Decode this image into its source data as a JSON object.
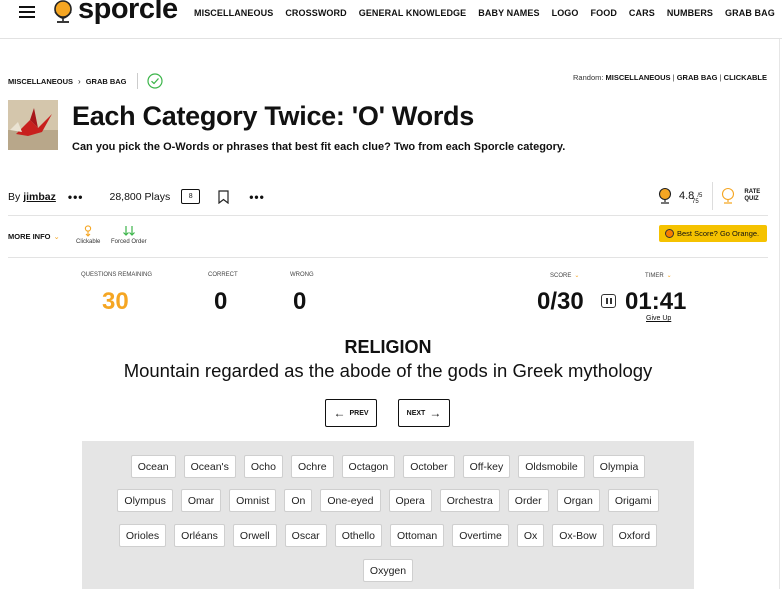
{
  "nav": {
    "logo": "sporcle",
    "links": [
      "MISCELLANEOUS",
      "CROSSWORD",
      "GENERAL KNOWLEDGE",
      "BABY NAMES",
      "LOGO",
      "FOOD",
      "CARS",
      "NUMBERS",
      "GRAB BAG"
    ]
  },
  "breadcrumb": {
    "first": "MISCELLANEOUS",
    "second": "GRAB BAG"
  },
  "random": {
    "label": "Random:",
    "links": [
      "MISCELLANEOUS",
      "GRAB BAG",
      "CLICKABLE"
    ]
  },
  "quiz": {
    "title": "Each Category Twice: 'O' Words",
    "subtitle": "Can you pick the O-Words or phrases that best fit each clue? Two from each Sporcle category.",
    "by_label": "By",
    "author": "jimbaz",
    "plays": "28,800 Plays",
    "comments": "8",
    "rating": "4.8",
    "rating_max": "/5",
    "rating_count": "75",
    "rate_label_1": "RATE",
    "rate_label_2": "QUIZ"
  },
  "info": {
    "more_info": "MORE INFO",
    "tags": [
      "Clickable",
      "Forced Order"
    ],
    "best_score": "Best Score? Go Orange."
  },
  "stats": {
    "remaining_label": "QUESTIONS REMAINING",
    "remaining": "30",
    "correct_label": "CORRECT",
    "correct": "0",
    "wrong_label": "WRONG",
    "wrong": "0",
    "score_label": "SCORE",
    "score": "0/30",
    "timer_label": "TIMER",
    "timer": "01:41",
    "give_up": "Give Up"
  },
  "question": {
    "category": "RELIGION",
    "clue": "Mountain regarded as the abode of the gods in Greek mythology",
    "prev": "PREV",
    "next": "NEXT"
  },
  "answers": [
    [
      "Ocean",
      "Ocean's",
      "Ocho",
      "Ochre",
      "Octagon",
      "October",
      "Off-key",
      "Oldsmobile",
      "Olympia"
    ],
    [
      "Olympus",
      "Omar",
      "Omnist",
      "On",
      "One-eyed",
      "Opera",
      "Orchestra",
      "Order",
      "Organ",
      "Origami"
    ],
    [
      "Orioles",
      "Orléans",
      "Orwell",
      "Oscar",
      "Othello",
      "Ottoman",
      "Overtime",
      "Ox",
      "Ox-Bow",
      "Oxford"
    ],
    [
      "Oxygen"
    ]
  ],
  "colors": {
    "accent": "#f5a623",
    "best_score_bg": "#f5c200",
    "panel_bg": "#e5e5e5"
  }
}
